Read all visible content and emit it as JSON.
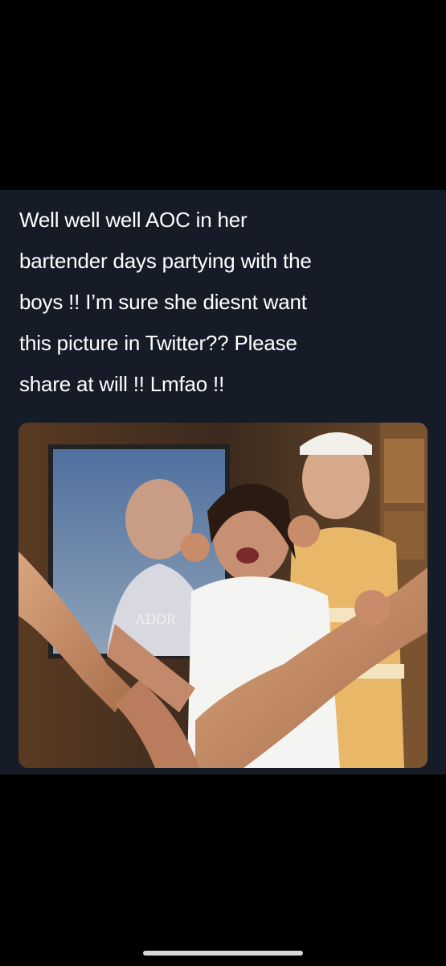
{
  "post": {
    "text_lines": [
      "Well well well AOC in her",
      "bartender days partying with the",
      "boys !! I’m sure she diesnt want",
      "this  picture in Twitter?? Please",
      "share at will  !! Lmfao !!"
    ],
    "photo_text": "ADDR"
  },
  "colors": {
    "background": "#000000",
    "post_background": "#151c28",
    "text": "#ffffff",
    "home_indicator": "#d8d8d8"
  }
}
